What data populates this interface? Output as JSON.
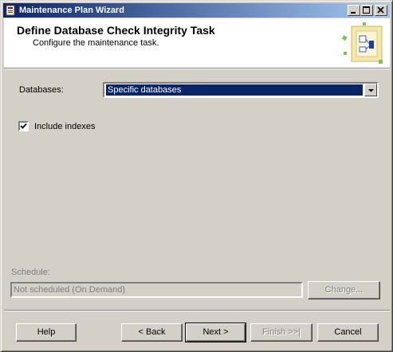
{
  "window": {
    "title": "Maintenance Plan Wizard"
  },
  "header": {
    "title": "Define Database Check Integrity Task",
    "subtitle": "Configure the maintenance task."
  },
  "databases": {
    "label": "Databases:",
    "value": "Specific databases"
  },
  "include_indexes": {
    "label": "Include indexes",
    "checked": true
  },
  "schedule": {
    "label": "Schedule:",
    "value": "Not scheduled (On Demand)",
    "change_label": "Change..."
  },
  "footer": {
    "help": "Help",
    "back": "< Back",
    "next": "Next >",
    "finish": "Finish >>|",
    "cancel": "Cancel"
  },
  "colors": {
    "title_bar_start": "#0a246a",
    "title_bar_end": "#a6caf0",
    "selection": "#0a246a",
    "face": "#d4d0c8"
  }
}
